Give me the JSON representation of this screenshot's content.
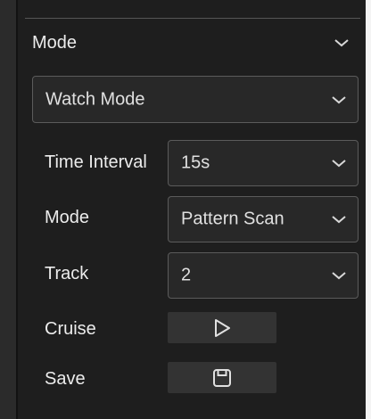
{
  "panel": {
    "section": {
      "title": "Mode",
      "icon": "chevron-down-icon"
    },
    "watch_mode_select": {
      "value": "Watch Mode"
    },
    "rows": {
      "time_interval": {
        "label": "Time Interval",
        "value": "15s"
      },
      "mode": {
        "label": "Mode",
        "value": "Pattern Scan"
      },
      "track": {
        "label": "Track",
        "value": "2"
      },
      "cruise": {
        "label": "Cruise",
        "icon": "play-icon"
      },
      "save": {
        "label": "Save",
        "icon": "save-icon"
      }
    }
  },
  "colors": {
    "background": "#1e1e1e",
    "field": "#282828",
    "border": "#5b5b5b",
    "button": "#333333",
    "text": "#e6e6e6"
  }
}
